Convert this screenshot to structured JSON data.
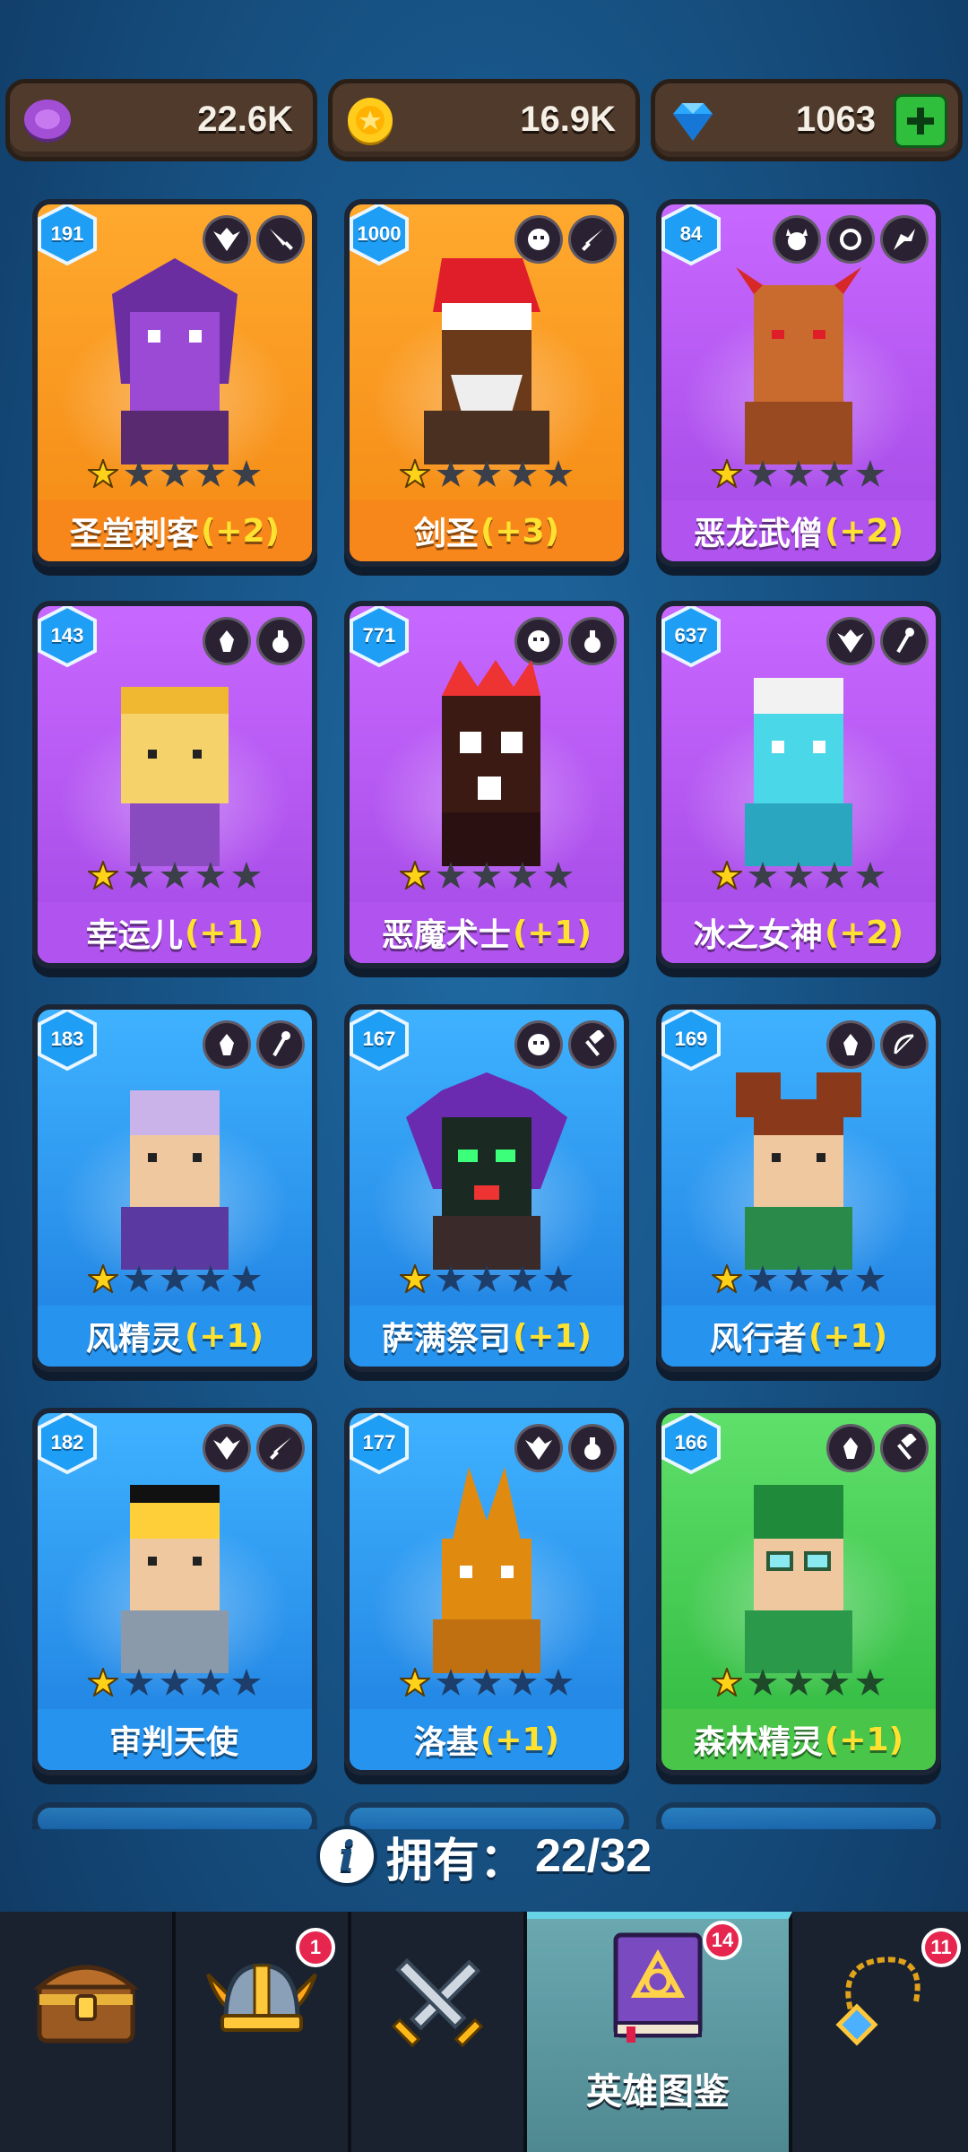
{
  "currencies": [
    {
      "name": "purple-gem",
      "value": "22.6K"
    },
    {
      "name": "gold-coin",
      "value": "16.9K"
    },
    {
      "name": "diamond",
      "value": "1063"
    }
  ],
  "heroes": [
    {
      "level": "191",
      "name": "圣堂刺客",
      "bonus": "(+2)",
      "rarity": "orange",
      "stars": 1
    },
    {
      "level": "1000",
      "name": "剑圣",
      "bonus": "(+3)",
      "rarity": "orange",
      "stars": 1
    },
    {
      "level": "84",
      "name": "恶龙武僧",
      "bonus": "(+2)",
      "rarity": "purple",
      "stars": 1
    },
    {
      "level": "143",
      "name": "幸运儿",
      "bonus": "(+1)",
      "rarity": "purple",
      "stars": 1
    },
    {
      "level": "771",
      "name": "恶魔术士",
      "bonus": "(+1)",
      "rarity": "purple",
      "stars": 1
    },
    {
      "level": "637",
      "name": "冰之女神",
      "bonus": "(+2)",
      "rarity": "purple",
      "stars": 1
    },
    {
      "level": "183",
      "name": "风精灵",
      "bonus": "(+1)",
      "rarity": "blue",
      "stars": 1
    },
    {
      "level": "167",
      "name": "萨满祭司",
      "bonus": "(+1)",
      "rarity": "blue",
      "stars": 1
    },
    {
      "level": "169",
      "name": "风行者",
      "bonus": "(+1)",
      "rarity": "blue",
      "stars": 1
    },
    {
      "level": "182",
      "name": "审判天使",
      "bonus": "",
      "rarity": "blue",
      "stars": 1
    },
    {
      "level": "177",
      "name": "洛基",
      "bonus": "(+1)",
      "rarity": "blue",
      "stars": 1
    },
    {
      "level": "166",
      "name": "森林精灵",
      "bonus": "(+1)",
      "rarity": "green",
      "stars": 1
    }
  ],
  "owned": {
    "label": "拥有：",
    "value": "22/32"
  },
  "nav": {
    "tabs": [
      {
        "id": "chest",
        "label": "",
        "badge": ""
      },
      {
        "id": "heroes",
        "label": "",
        "badge": "1"
      },
      {
        "id": "battle",
        "label": "",
        "badge": ""
      },
      {
        "id": "codex",
        "label": "英雄图鉴",
        "badge": "14"
      },
      {
        "id": "equipment",
        "label": "",
        "badge": "11"
      }
    ]
  }
}
